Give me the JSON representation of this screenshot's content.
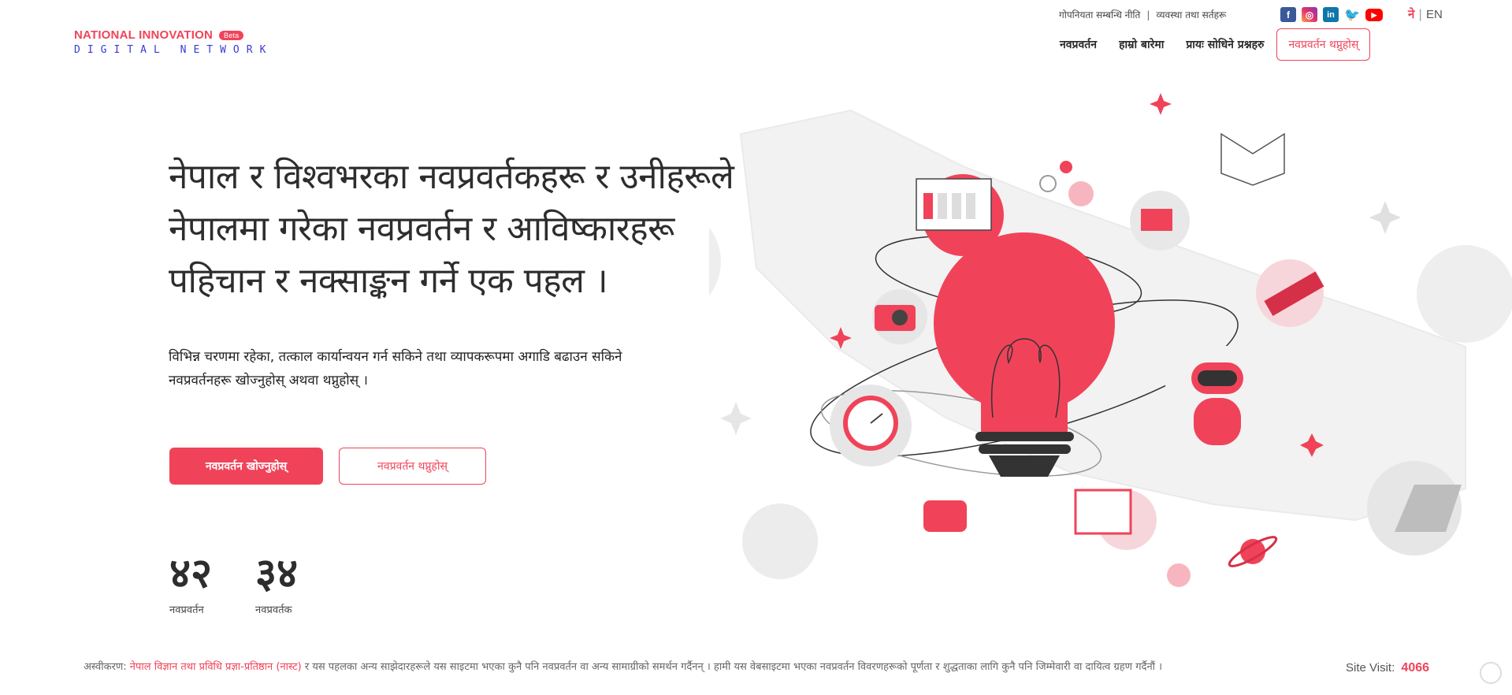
{
  "brand": {
    "name_line1": "NATIONAL INNOVATION",
    "badge": "Beta",
    "name_line2": "DIGITAL NETWORK"
  },
  "top_links": {
    "privacy": "गोपनियता सम्बन्धि नीति",
    "separator": "|",
    "terms": "व्यवस्था तथा सर्तहरू"
  },
  "socials": [
    {
      "name": "facebook-icon",
      "glyph": "f"
    },
    {
      "name": "instagram-icon",
      "glyph": "◎"
    },
    {
      "name": "linkedin-icon",
      "glyph": "in"
    },
    {
      "name": "twitter-icon",
      "glyph": "🐦"
    },
    {
      "name": "youtube-icon",
      "glyph": "▶"
    }
  ],
  "language": {
    "ne": "ने",
    "separator": "|",
    "en": "EN"
  },
  "nav": {
    "innovation": "नवप्रवर्तन",
    "about": "हाम्रो बारेमा",
    "faq": "प्रायः सोधिने प्रश्नहरु",
    "add_innovation": "नवप्रवर्तन थप्नुहोस्"
  },
  "hero": {
    "title": "नेपाल र विश्वभरका नवप्रवर्तकहरू र उनीहरूले नेपालमा गरेका नवप्रवर्तन र आविष्कारहरू पहिचान र नक्साङ्कन गर्ने एक पहल ।",
    "subtitle": "विभिन्न चरणमा रहेका, तत्काल कार्यान्वयन गर्न सकिने तथा व्यापकरूपमा अगाडि बढाउन सकिने नवप्रवर्तनहरू खोज्नुहोस् अथवा थप्नुहोस् ।",
    "search_button": "नवप्रवर्तन खोज्नुहोस्",
    "add_button": "नवप्रवर्तन थप्नुहोस्"
  },
  "stats": [
    {
      "value": "४२",
      "label": "नवप्रवर्तन"
    },
    {
      "value": "३४",
      "label": "नवप्रवर्तक"
    }
  ],
  "footer": {
    "disclaimer_prefix": "अस्वीकरण: ",
    "disclaimer_org": "नेपाल विज्ञान तथा प्रविधि प्रज्ञा-प्रतिष्ठान (नास्ट)",
    "disclaimer_rest": " र यस पहलका अन्य साझेदारहरूले यस साइटमा भएका कुनै पनि नवप्रवर्तन वा अन्य सामाग्रीको समर्थन गर्दैनन् । हामी यस वेबसाइटमा भएका नवप्रवर्तन विवरणहरूको पूर्णता र शुद्धताका लागि कुनै पनि जिम्मेवारी वा दायित्व ग्रहण गर्दैनौं ।",
    "site_visit_label": "Site Visit:",
    "site_visit_count": "4066"
  },
  "colors": {
    "accent": "#f04359",
    "logo_secondary": "#3a3ad6",
    "illustration_gray": "#e8e8e8"
  }
}
